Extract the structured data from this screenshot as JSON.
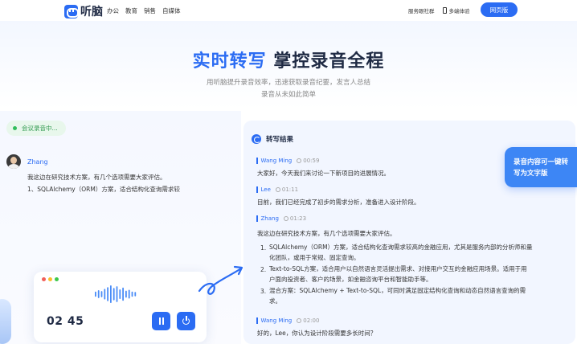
{
  "nav": {
    "logo_text": "听脑",
    "links": [
      "办公",
      "教育",
      "销售",
      "自媒体"
    ],
    "follow_label": "服务眼社群",
    "device_label": "多端体验",
    "web_button": "网页版"
  },
  "hero": {
    "title_accent": "实时转写",
    "title_rest": "掌控录音全程",
    "subtitle_line1": "用听脑提升录音效率，迅速获取录音纪要，发言人总结",
    "subtitle_line2": "录音从未如此简单"
  },
  "left": {
    "status": "会议录音中...",
    "speaker": "Zhang",
    "speech_line1": "我这边在研究技术方案，有几个选项需要大家评估。",
    "speech_line2": "1、SQLAlchemy（ORM）方案，适合结构化查询需求较",
    "recorder": {
      "timer": "02 45",
      "dot_colors": [
        "#f25f58",
        "#fbbe2e",
        "#3cc84a"
      ],
      "wave_levels": [
        0.3,
        0.45,
        0.35,
        0.6,
        0.8,
        1.0,
        0.7,
        0.9,
        0.55,
        0.75,
        0.4,
        0.5,
        0.3,
        0.25
      ]
    }
  },
  "right": {
    "title": "转写结果",
    "entries": [
      {
        "name": "Wang Ming",
        "time": "00:59",
        "text": "大家好，今天我们来讨论一下新项目的进展情况。"
      },
      {
        "name": "Lee",
        "time": "01:11",
        "text": "目前，我们已经完成了初步的需求分析，准备进入设计阶段。"
      },
      {
        "name": "Zhang",
        "time": "01:23",
        "text": "我这边在研究技术方案，有几个选项需要大家评估。",
        "items": [
          {
            "num": "1.",
            "line1": "SQLAlchemy（ORM）方案，适合结构化查询需求较高的金融应用，尤其是服务内部的分析师和量",
            "line2": "化团队，或用于常规、固定查询。"
          },
          {
            "num": "2.",
            "line1": "Text-to-SQL方案，适合用户以自然语言灵活提出需求、对接用户交互的金融应用场景。适用于用",
            "line2": "户面向投资者、客户的场景，如金融咨询平台和智能助手等。"
          },
          {
            "num": "3.",
            "line1": "混合方案：SQLAlchemy + Text-to-SQL，可同时满足固定结构化查询和动态自然语言查询的需",
            "line2": "求。"
          }
        ]
      },
      {
        "name": "Wang Ming",
        "time": "02:00",
        "text": "好的，Lee，你认为设计阶段需要多长时间？"
      }
    ]
  },
  "bubble": {
    "line1": "录音内容可一键转",
    "line2": "写为文字版"
  },
  "colors": {
    "accent": "#2b6cf3",
    "status_green": "#2fbd5b"
  }
}
